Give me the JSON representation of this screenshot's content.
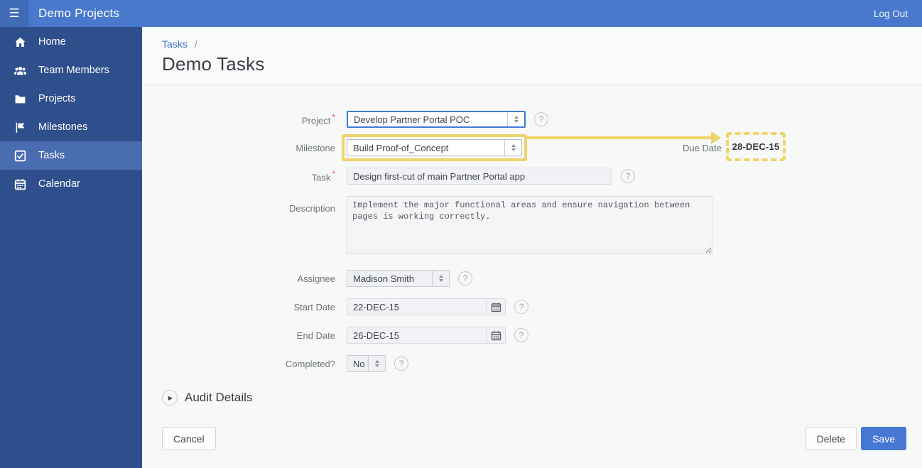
{
  "header": {
    "title": "Demo Projects",
    "logout_label": "Log Out"
  },
  "icons": {
    "hamburger": "☰",
    "help": "?",
    "audit_expand": "▶"
  },
  "sidebar": {
    "items": [
      {
        "label": "Home",
        "icon": "home-icon",
        "active": false
      },
      {
        "label": "Team Members",
        "icon": "team-members-icon",
        "active": false
      },
      {
        "label": "Projects",
        "icon": "projects-folder-icon",
        "active": false
      },
      {
        "label": "Milestones",
        "icon": "milestones-flag-icon",
        "active": false
      },
      {
        "label": "Tasks",
        "icon": "tasks-check-icon",
        "active": true
      },
      {
        "label": "Calendar",
        "icon": "calendar-icon",
        "active": false
      }
    ]
  },
  "breadcrumb": {
    "link": "Tasks",
    "separator": "/"
  },
  "page": {
    "title": "Demo Tasks"
  },
  "form": {
    "required_marker": "*",
    "project": {
      "label": "Project",
      "value": "Develop Partner Portal POC",
      "required": true
    },
    "milestone": {
      "label": "Milestone",
      "value": "Build Proof-of_Concept"
    },
    "due_date": {
      "label": "Due Date",
      "value": "28-DEC-15"
    },
    "task": {
      "label": "Task",
      "value": "Design first-cut of main Partner Portal app",
      "required": true
    },
    "description": {
      "label": "Description",
      "value": "Implement the major functional areas and ensure navigation between\npages is working correctly."
    },
    "assignee": {
      "label": "Assignee",
      "value": "Madison Smith"
    },
    "start_date": {
      "label": "Start Date",
      "value": "22-DEC-15"
    },
    "end_date": {
      "label": "End Date",
      "value": "26-DEC-15"
    },
    "completed": {
      "label": "Completed?",
      "value": "No"
    }
  },
  "audit": {
    "label": "Audit Details"
  },
  "buttons": {
    "cancel": "Cancel",
    "delete": "Delete",
    "save": "Save"
  },
  "colors": {
    "header_blue": "#4879cc",
    "sidebar_blue": "#2f4e8c",
    "active_blue": "#4a6cb0",
    "link_blue": "#3d72c9",
    "yellow": "#efd469",
    "save_blue": "#4677d4",
    "bg_main": "#f7f8f8",
    "bg_titlebar": "#f9fafc",
    "input_bg": "#f1f2f5",
    "input_border": "#d8dbe0",
    "label_gray": "#6e7378",
    "text_dark": "#3f444a"
  }
}
